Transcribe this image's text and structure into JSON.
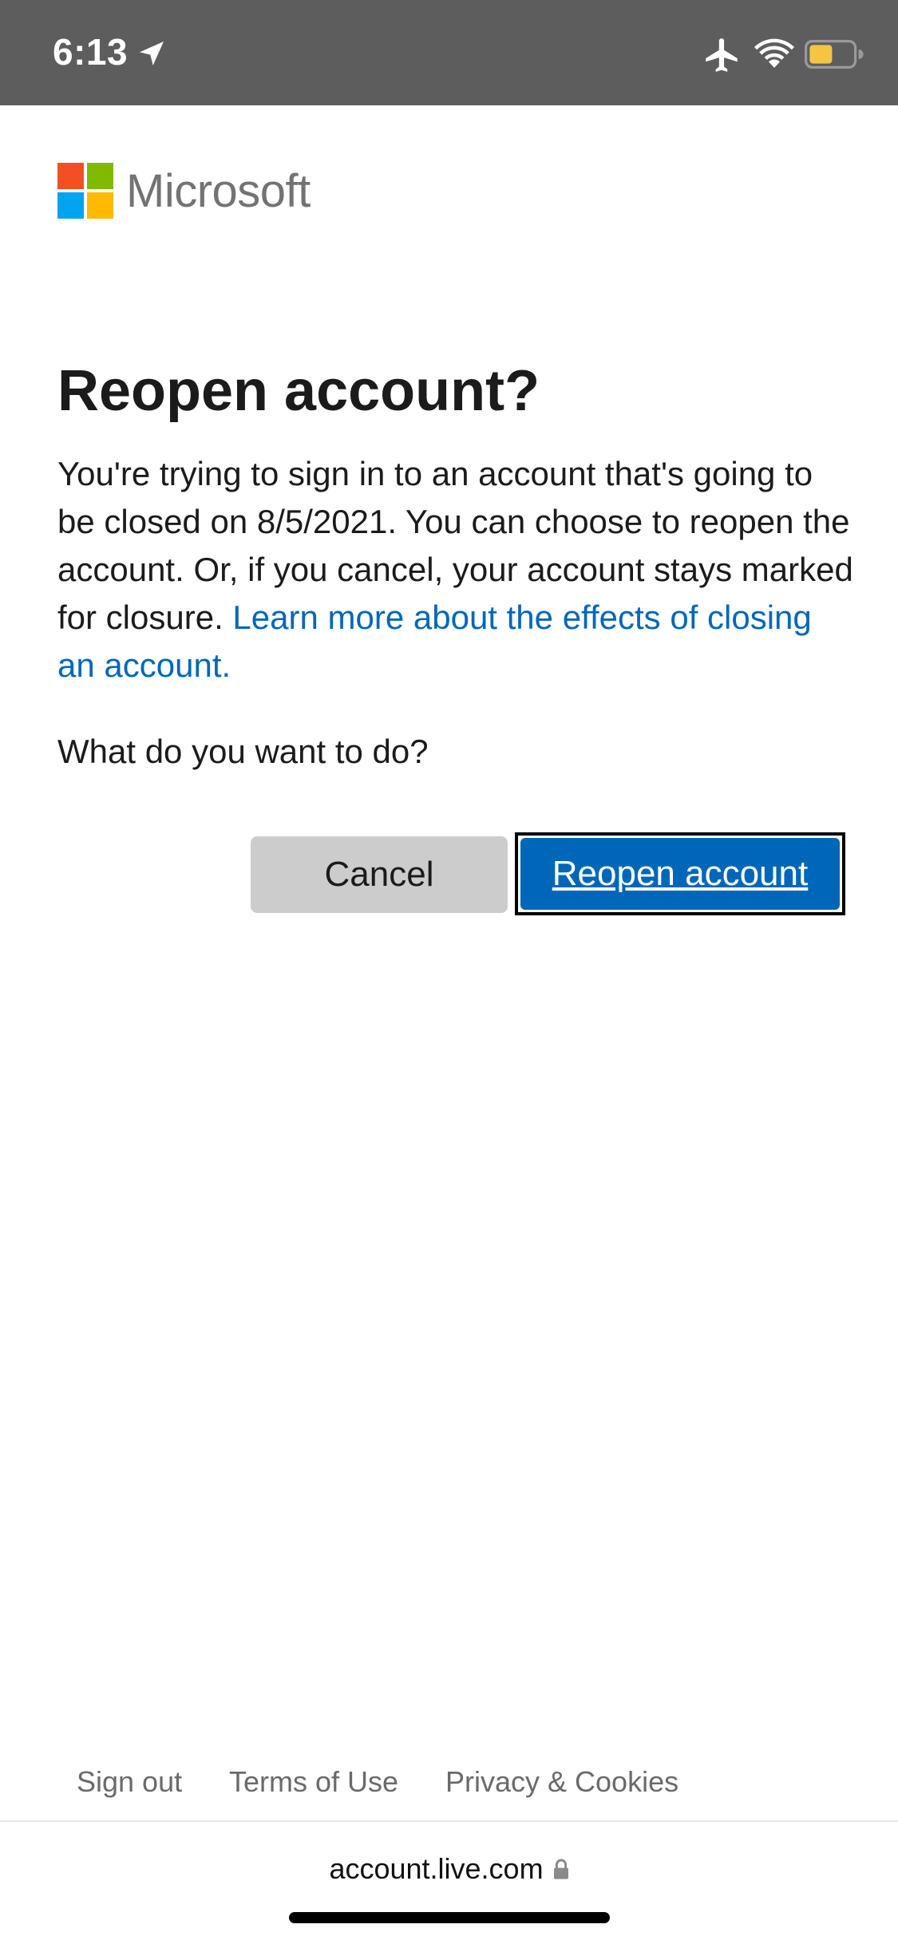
{
  "status_bar": {
    "time": "6:13",
    "icons": [
      "location-arrow-icon",
      "airplane-icon",
      "wifi-icon",
      "battery-icon"
    ],
    "battery_color": "#f5c542"
  },
  "brand": {
    "name": "Microsoft",
    "logo_colors": [
      "#f25022",
      "#7fba00",
      "#00a4ef",
      "#ffb900"
    ]
  },
  "page": {
    "title": "Reopen account?",
    "message": "You're trying to sign in to an account that's going to be closed on 8/5/2021. You can choose to reopen the account. Or, if you cancel, your account stays marked for closure.",
    "learn_more_link": "Learn more about the effects of closing an account.",
    "question": "What do you want to do?"
  },
  "actions": {
    "cancel_label": "Cancel",
    "reopen_label": "Reopen account"
  },
  "footer": {
    "links": [
      "Sign out",
      "Terms of Use",
      "Privacy & Cookies"
    ]
  },
  "browser": {
    "url": "account.live.com"
  },
  "colors": {
    "accent": "#0067b8",
    "status_bar_bg": "#5d5d5d",
    "cancel_bg": "#cccccc"
  }
}
